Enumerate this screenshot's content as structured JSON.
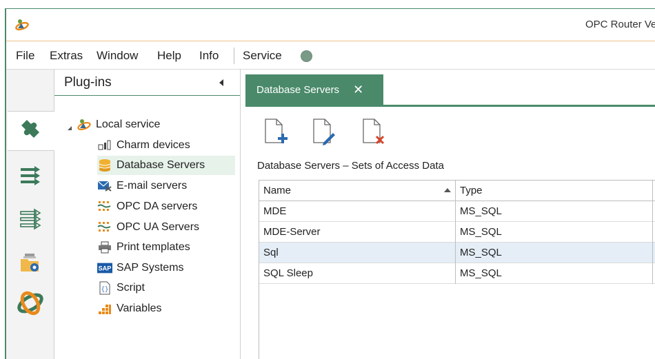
{
  "window": {
    "title": "OPC Router Ve",
    "logo_icon": "opc-router-logo-icon"
  },
  "menu": {
    "items": [
      "File",
      "Extras",
      "Window",
      "Help",
      "Info",
      "Service"
    ],
    "service_status_color": "#7a9a88"
  },
  "iconbar": {
    "items": [
      {
        "icon": "plugin-puzzle-icon",
        "active": true
      },
      {
        "icon": "connections-arrows-icon",
        "active": false
      },
      {
        "icon": "templates-arrows-icon",
        "active": false
      },
      {
        "icon": "folder-settings-icon",
        "active": false
      },
      {
        "icon": "opc-router-logo-icon",
        "active": false
      }
    ]
  },
  "plugins": {
    "title": "Plug-ins",
    "root": "Local service",
    "items": [
      {
        "label": "Charm devices",
        "icon": "charm-devices-icon"
      },
      {
        "label": "Database Servers",
        "icon": "database-icon",
        "selected": true
      },
      {
        "label": "E-mail servers",
        "icon": "email-icon"
      },
      {
        "label": "OPC DA servers",
        "icon": "opc-da-icon"
      },
      {
        "label": "OPC UA Servers",
        "icon": "opc-ua-icon"
      },
      {
        "label": "Print templates",
        "icon": "printer-icon"
      },
      {
        "label": "SAP Systems",
        "icon": "sap-icon"
      },
      {
        "label": "Script",
        "icon": "script-icon"
      },
      {
        "label": "Variables",
        "icon": "variables-icon"
      }
    ]
  },
  "content": {
    "tab_label": "Database Servers",
    "tab_close": "✕",
    "toolbar": [
      "new-document-icon",
      "edit-document-icon",
      "delete-document-icon"
    ],
    "section_title": "Database Servers – Sets of Access Data",
    "columns": [
      "Name",
      "Type"
    ],
    "rows": [
      {
        "name": "MDE",
        "type": "MS_SQL"
      },
      {
        "name": "MDE-Server",
        "type": "MS_SQL"
      },
      {
        "name": "Sql",
        "type": "MS_SQL",
        "selected": true
      },
      {
        "name": "SQL Sleep",
        "type": "MS_SQL"
      }
    ]
  },
  "colors": {
    "accent": "#4a8a6a",
    "selected_row": "#e5eef7",
    "selected_tree": "#e6f2ea"
  }
}
